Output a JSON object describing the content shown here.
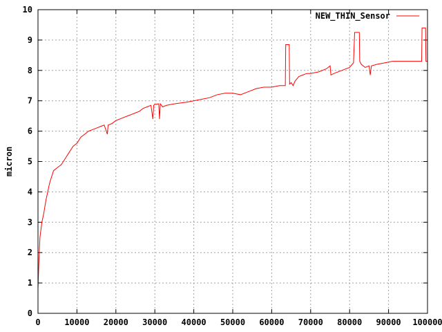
{
  "chart_data": {
    "type": "line",
    "title": "",
    "xlabel": "",
    "ylabel": "micron",
    "xlim": [
      0,
      100000
    ],
    "ylim": [
      0,
      10
    ],
    "grid": true,
    "legend_position": "top-right",
    "x_ticks": [
      "0",
      "10000",
      "20000",
      "30000",
      "40000",
      "50000",
      "60000",
      "70000",
      "80000",
      "90000",
      "100000"
    ],
    "y_ticks": [
      "0",
      "1",
      "2",
      "3",
      "4",
      "5",
      "6",
      "7",
      "8",
      "9",
      "10"
    ],
    "series": [
      {
        "name": "NEW_THIN_Sensor",
        "color": "#ff0000",
        "points": [
          [
            0,
            0.8
          ],
          [
            200,
            1.6
          ],
          [
            500,
            2.5
          ],
          [
            1000,
            3.0
          ],
          [
            1500,
            3.3
          ],
          [
            2000,
            3.7
          ],
          [
            2500,
            4.0
          ],
          [
            3000,
            4.3
          ],
          [
            3500,
            4.5
          ],
          [
            4000,
            4.7
          ],
          [
            5000,
            4.8
          ],
          [
            6000,
            4.9
          ],
          [
            7000,
            5.1
          ],
          [
            8000,
            5.3
          ],
          [
            9000,
            5.5
          ],
          [
            10000,
            5.6
          ],
          [
            11000,
            5.8
          ],
          [
            12000,
            5.9
          ],
          [
            13000,
            6.0
          ],
          [
            14000,
            6.05
          ],
          [
            15000,
            6.1
          ],
          [
            16000,
            6.15
          ],
          [
            17000,
            6.2
          ],
          [
            17800,
            5.9
          ],
          [
            18000,
            6.2
          ],
          [
            19000,
            6.25
          ],
          [
            20000,
            6.35
          ],
          [
            21000,
            6.4
          ],
          [
            22000,
            6.45
          ],
          [
            23000,
            6.5
          ],
          [
            24000,
            6.55
          ],
          [
            25000,
            6.6
          ],
          [
            26000,
            6.65
          ],
          [
            27000,
            6.75
          ],
          [
            28000,
            6.8
          ],
          [
            29000,
            6.85
          ],
          [
            29500,
            6.4
          ],
          [
            29700,
            6.85
          ],
          [
            30000,
            6.88
          ],
          [
            31000,
            6.9
          ],
          [
            31200,
            6.4
          ],
          [
            31400,
            6.9
          ],
          [
            32000,
            6.8
          ],
          [
            33000,
            6.85
          ],
          [
            35000,
            6.9
          ],
          [
            38000,
            6.95
          ],
          [
            40000,
            7.0
          ],
          [
            42000,
            7.05
          ],
          [
            44000,
            7.1
          ],
          [
            46000,
            7.2
          ],
          [
            48000,
            7.25
          ],
          [
            50000,
            7.25
          ],
          [
            52000,
            7.2
          ],
          [
            54000,
            7.3
          ],
          [
            56000,
            7.4
          ],
          [
            58000,
            7.45
          ],
          [
            60000,
            7.45
          ],
          [
            62000,
            7.5
          ],
          [
            63500,
            7.5
          ],
          [
            63600,
            8.85
          ],
          [
            64500,
            8.85
          ],
          [
            64600,
            7.55
          ],
          [
            65000,
            7.6
          ],
          [
            65500,
            7.5
          ],
          [
            66000,
            7.65
          ],
          [
            67000,
            7.8
          ],
          [
            68000,
            7.85
          ],
          [
            69000,
            7.9
          ],
          [
            70000,
            7.9
          ],
          [
            72000,
            7.95
          ],
          [
            74000,
            8.05
          ],
          [
            75000,
            8.15
          ],
          [
            75200,
            7.85
          ],
          [
            76000,
            7.9
          ],
          [
            78000,
            8.0
          ],
          [
            80000,
            8.1
          ],
          [
            81000,
            8.25
          ],
          [
            81300,
            9.25
          ],
          [
            82500,
            9.25
          ],
          [
            82600,
            8.3
          ],
          [
            83000,
            8.2
          ],
          [
            84000,
            8.1
          ],
          [
            85000,
            8.15
          ],
          [
            85300,
            7.85
          ],
          [
            85600,
            8.15
          ],
          [
            87000,
            8.2
          ],
          [
            89000,
            8.25
          ],
          [
            91000,
            8.3
          ],
          [
            92000,
            8.3
          ],
          [
            94000,
            8.3
          ],
          [
            96000,
            8.3
          ],
          [
            98000,
            8.3
          ],
          [
            98500,
            8.3
          ],
          [
            98600,
            9.4
          ],
          [
            99500,
            9.4
          ],
          [
            99600,
            8.3
          ],
          [
            100000,
            8.3
          ]
        ]
      }
    ]
  }
}
